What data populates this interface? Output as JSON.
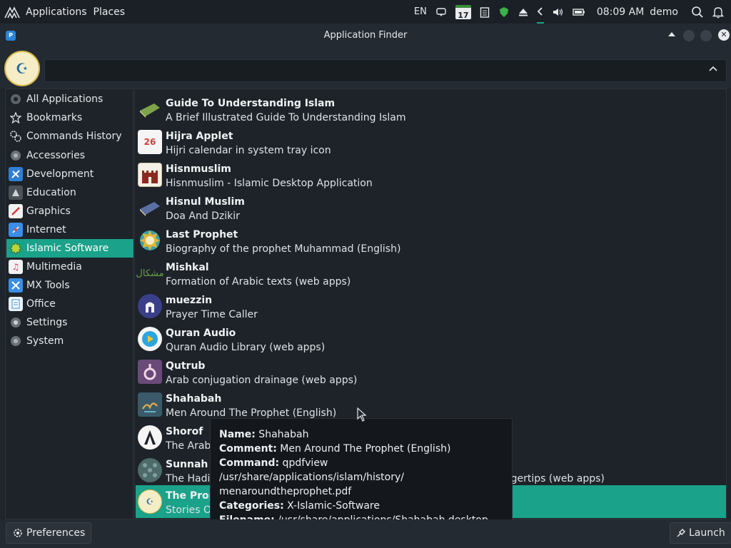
{
  "panel": {
    "menu_applications": "Applications",
    "menu_places": "Places",
    "lang": "EN",
    "calendar_day": "17",
    "time": "08:09 AM",
    "user": "demo"
  },
  "window": {
    "title": "Application Finder",
    "close_glyph": "✕"
  },
  "search": {
    "value": "",
    "placeholder": ""
  },
  "categories": [
    {
      "label": "All Applications",
      "icon": "all-apps-icon"
    },
    {
      "label": "Bookmarks",
      "icon": "star-icon"
    },
    {
      "label": "Commands History",
      "icon": "gears-icon"
    },
    {
      "label": "Accessories",
      "icon": "accessories-icon"
    },
    {
      "label": "Development",
      "icon": "development-icon"
    },
    {
      "label": "Education",
      "icon": "education-icon"
    },
    {
      "label": "Graphics",
      "icon": "graphics-icon"
    },
    {
      "label": "Internet",
      "icon": "internet-icon"
    },
    {
      "label": "Islamic Software",
      "icon": "islamic-icon",
      "selected": true
    },
    {
      "label": "Multimedia",
      "icon": "multimedia-icon"
    },
    {
      "label": "MX Tools",
      "icon": "mx-tools-icon"
    },
    {
      "label": "Office",
      "icon": "office-icon"
    },
    {
      "label": "Settings",
      "icon": "settings-icon"
    },
    {
      "label": "System",
      "icon": "system-icon"
    }
  ],
  "apps": [
    {
      "name": "Guide To Understanding Islam",
      "desc": "A Brief Illustrated Guide To Understanding Islam",
      "icon": "book-icon"
    },
    {
      "name": "Hijra Applet",
      "desc": "Hijri calendar in system tray icon",
      "icon": "calendar-icon",
      "icon_text": "26"
    },
    {
      "name": "Hisnmuslim",
      "desc": "Hisnmuslim - Islamic Desktop Application",
      "icon": "fortress-icon"
    },
    {
      "name": "Hisnul Muslim",
      "desc": "Doa And Dzikir",
      "icon": "book-icon"
    },
    {
      "name": "Last Prophet",
      "desc": "Biography of the prophet Muhammad (English)",
      "icon": "emblem-icon"
    },
    {
      "name": "Mishkal",
      "desc": "Formation of Arabic texts (web apps)",
      "icon": "calligraphy-icon"
    },
    {
      "name": "muezzin",
      "desc": "Prayer Time Caller",
      "icon": "muezzin-icon"
    },
    {
      "name": "Quran Audio",
      "desc": "Quran Audio Library (web apps)",
      "icon": "play-icon"
    },
    {
      "name": "Qutrub",
      "desc": "Arab conjugation drainage (web apps)",
      "icon": "qutrub-icon"
    },
    {
      "name": "Shahabah",
      "desc": "Men Around The Prophet (English)",
      "icon": "shahabah-icon"
    },
    {
      "name": "Shorof",
      "desc": "The Arabic ...",
      "icon": "shorof-icon"
    },
    {
      "name": "Sunnah - H...",
      "desc": "The Hadith of the Prophet Muhammad (صلى الله عليه و سلم) at your fingertips (web apps)",
      "icon": "pattern-icon"
    },
    {
      "name": "The Proph...",
      "desc": "Stories O...",
      "icon": "prophet-icon",
      "selected": true
    }
  ],
  "tooltip": {
    "name_label": "Name:",
    "name_value": " Shahabah",
    "comment_label": "Comment:",
    "comment_value": " Men Around The Prophet (English)",
    "command_label": "Command:",
    "command_value": " qpdfview /usr/share/applications/islam/history/",
    "command_value2": "menaroundtheprophet.pdf",
    "categories_label": "Categories:",
    "categories_value": " X-Islamic-Software",
    "filename_label": "Filename:",
    "filename_value": " /usr/share/applications/Shahabah.desktop"
  },
  "buttons": {
    "preferences": "Preferences",
    "launch": "Launch"
  }
}
